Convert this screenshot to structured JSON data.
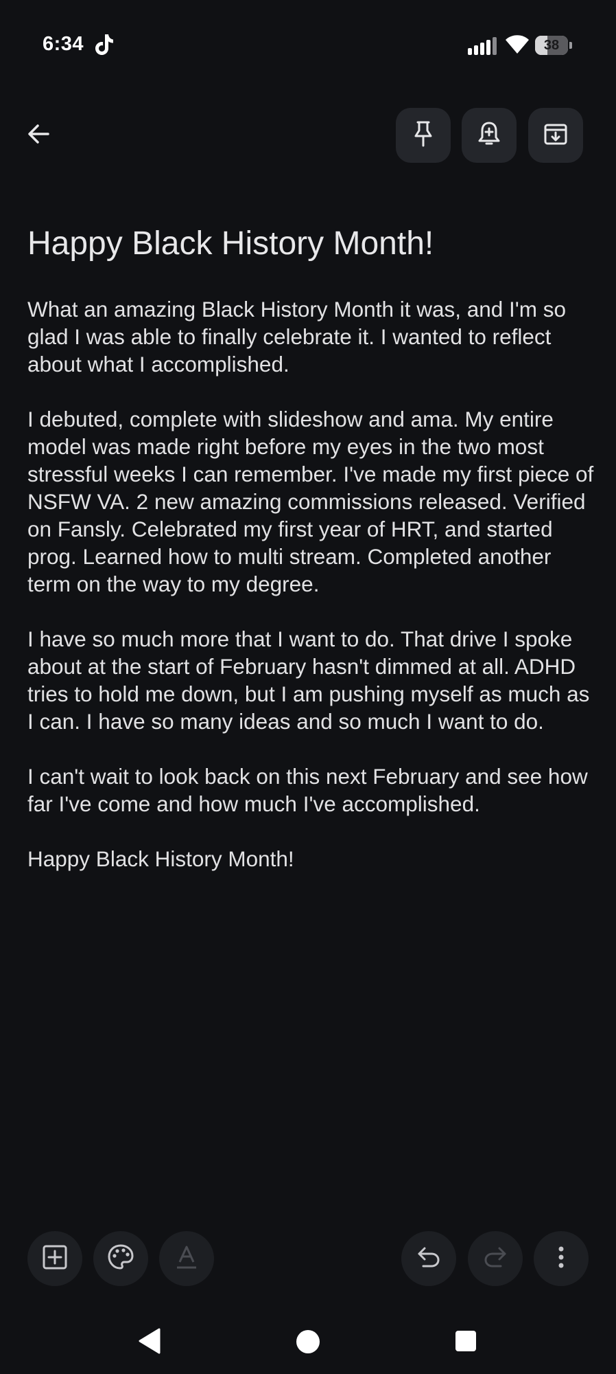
{
  "status_bar": {
    "time": "6:34",
    "battery_level": "38",
    "battery_fraction": 0.38
  },
  "toolbar": {
    "icons": [
      "back-arrow-icon",
      "pin-icon",
      "add-reminder-icon",
      "archive-icon"
    ]
  },
  "note": {
    "title": "Happy Black History Month!",
    "paragraphs": [
      "What an amazing Black History Month it was, and I'm so glad I was able to finally celebrate it. I wanted to reflect about what I accomplished.",
      "I debuted, complete with slideshow and ama. My entire model was made right before my eyes in the two most stressful weeks I can remember. I've made my first piece of NSFW VA. 2 new amazing commissions released. Verified on Fansly. Celebrated my first year of HRT, and started prog. Learned how to multi stream. Completed another term on the way to my degree.",
      "I have so much more that I want to do. That drive I spoke about at the start of February hasn't dimmed at all. ADHD tries to hold me down, but I am pushing myself as much as I can. I have so many ideas and so much I want to do.",
      "I can't wait to look back on this next February and see how far I've come and how much I've accomplished.",
      "Happy Black History Month!"
    ]
  },
  "bottom_toolbar": {
    "icons": [
      "add-box-icon",
      "palette-icon",
      "text-format-icon",
      "undo-icon",
      "redo-icon",
      "more-vert-icon"
    ]
  },
  "colors": {
    "background": "#101114",
    "button_bg": "#24262b",
    "text": "#e4e4e6",
    "disabled_icon": "#4a4c52"
  }
}
